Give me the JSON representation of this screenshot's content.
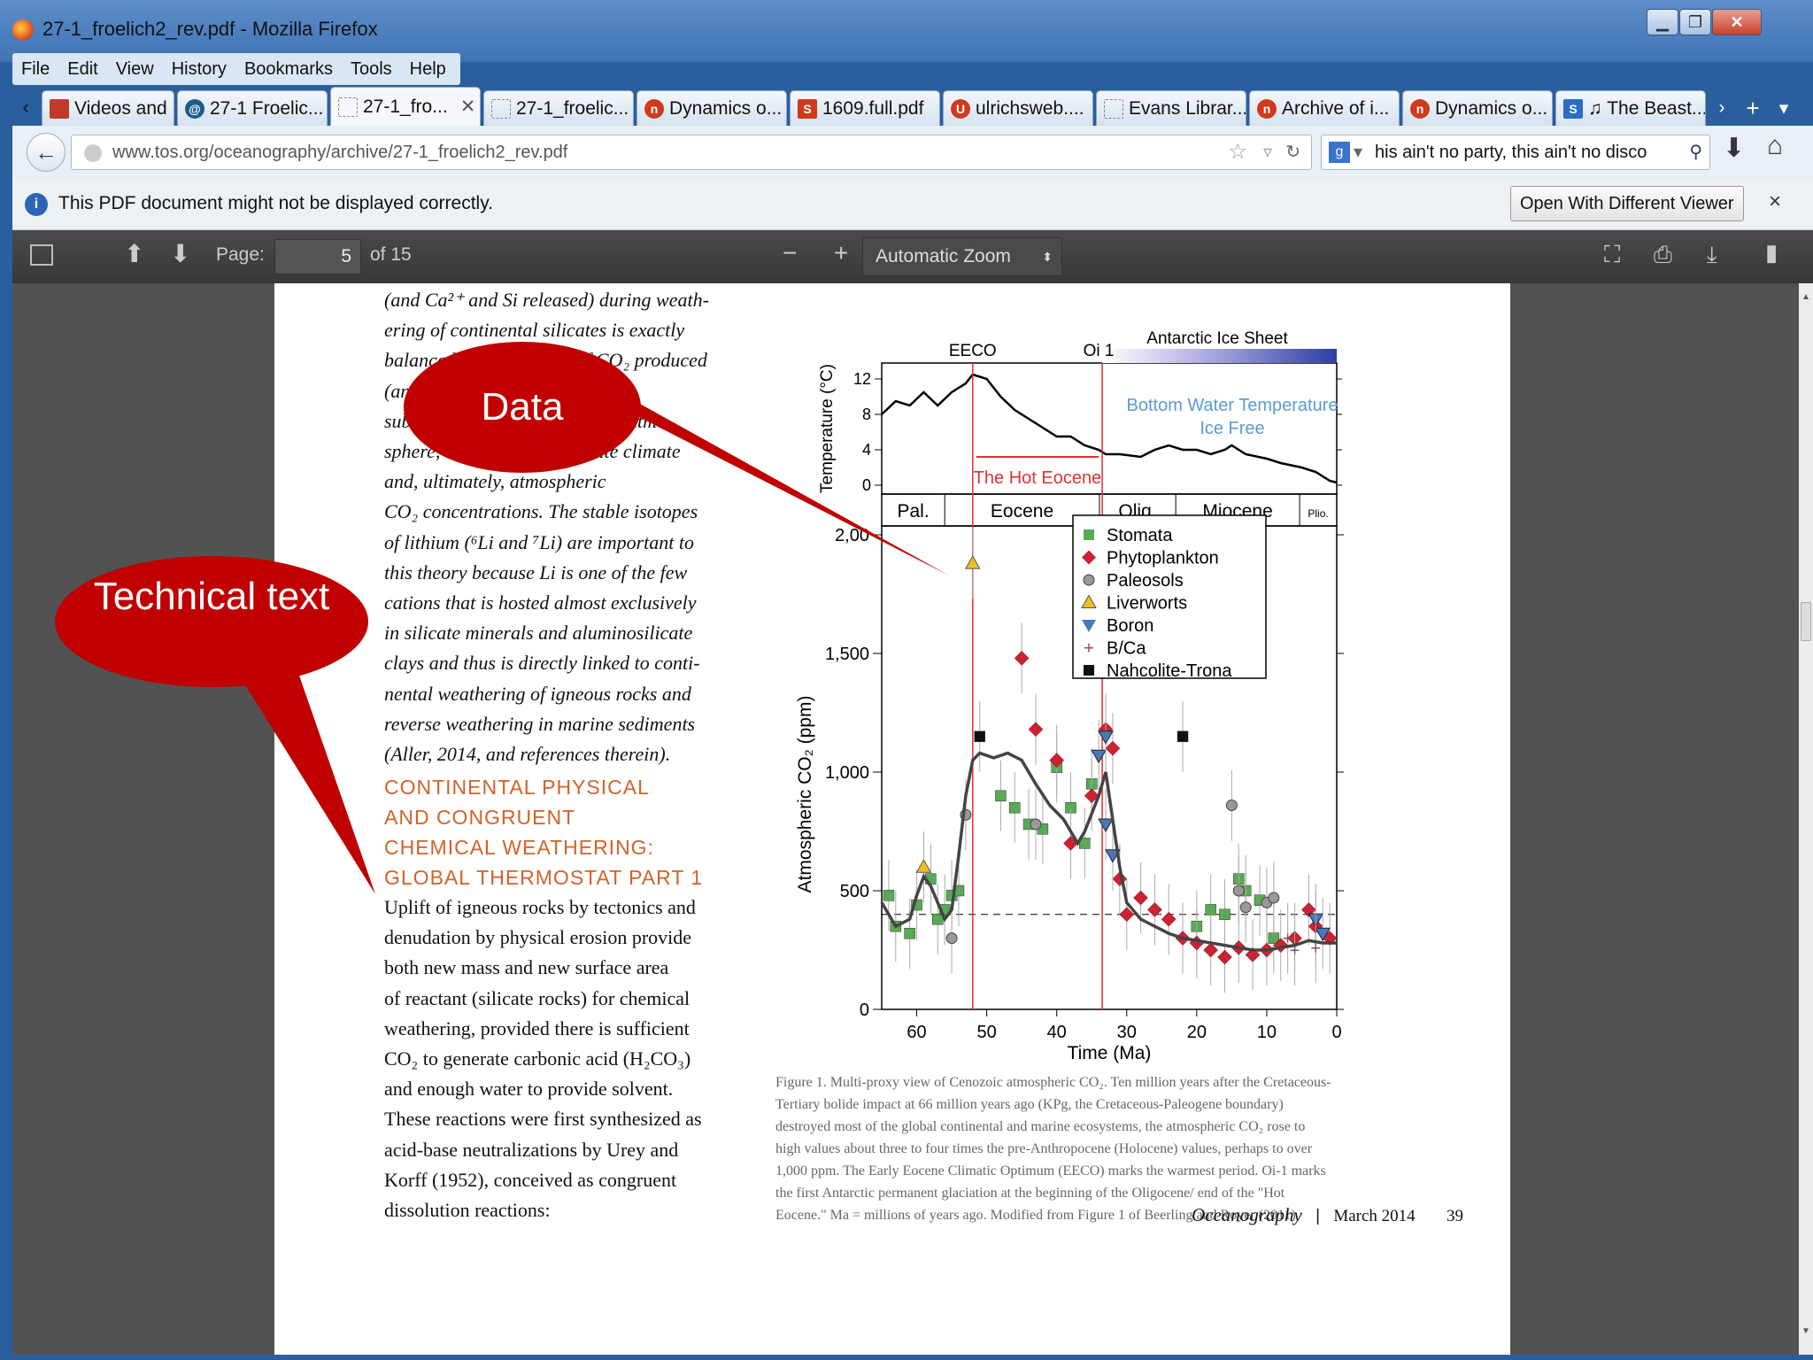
{
  "window": {
    "title": "27-1_froelich2_rev.pdf - Mozilla Firefox"
  },
  "menu": [
    "File",
    "Edit",
    "View",
    "History",
    "Bookmarks",
    "Tools",
    "Help"
  ],
  "tabs": [
    {
      "label": "Videos and I...",
      "icon": "video-icon",
      "color": "#c0392b"
    },
    {
      "label": "27-1 Froelic...",
      "icon": "globe-swirl-icon",
      "color": "#1b5e8a"
    },
    {
      "label": "27-1_fro...",
      "icon": "pdf-page-icon",
      "color": "#888",
      "active": true
    },
    {
      "label": "27-1_froelic...",
      "icon": "pdf-page-icon",
      "color": "#888"
    },
    {
      "label": "Dynamics o...",
      "icon": "library-icon",
      "color": "#d03a1b"
    },
    {
      "label": "1609.full.pdf",
      "icon": "s-icon",
      "color": "#d03a1b"
    },
    {
      "label": "ulrichsweb....",
      "icon": "u-icon",
      "color": "#d03a1b"
    },
    {
      "label": "Evans Librar...",
      "icon": "page-icon",
      "color": "#888"
    },
    {
      "label": "Archive of i...",
      "icon": "library-icon",
      "color": "#d03a1b"
    },
    {
      "label": "Dynamics o...",
      "icon": "library-icon",
      "color": "#d03a1b"
    },
    {
      "label": "♫ The Beast...",
      "icon": "s-blue-icon",
      "color": "#2a6cc7"
    }
  ],
  "nav": {
    "url": "www.tos.org/oceanography/archive/27-1_froelich2_rev.pdf",
    "search": "his ain't no party, this ain't no disco"
  },
  "notification": {
    "text": "This PDF document might not be displayed correctly.",
    "button": "Open With Different Viewer",
    "close": "×"
  },
  "pdf_toolbar": {
    "page_label": "Page:",
    "page_value": "5",
    "page_total": "of 15",
    "zoom": "Automatic Zoom"
  },
  "left_column": {
    "para1_lines": [
      "(and Ca²⁺ and Si released) during weath-",
      "ering of continental silicates is exactly",
      "balanced by the amount of CO₂ produced",
      "(and O₂ consumed) during",
      "subduction outgassing into the atmo-",
      "sphere, which might modulate climate",
      "and, ultimately, atmospheric",
      "CO₂ concentrations. The stable isotopes",
      "of lithium (⁶Li and ⁷Li) are important to",
      "this theory because Li is one of the few",
      "cations that is hosted almost exclusively",
      "in silicate minerals and aluminosilicate",
      "clays and thus is directly linked to conti-",
      "nental weathering of igneous rocks and",
      "reverse weathering in marine sediments",
      "(Aller, 2014, and references therein)."
    ],
    "heading_lines": [
      "CONTINENTAL PHYSICAL",
      "AND CONGRUENT",
      "CHEMICAL WEATHERING:",
      "GLOBAL THERMOSTAT PART 1"
    ],
    "para2_lines": [
      "Uplift of igneous rocks by tectonics and",
      "denudation by physical erosion provide",
      "both new mass and new surface area",
      "of reactant (silicate rocks) for chemical",
      "weathering, provided there is sufficient",
      "CO₂ to generate carbonic acid (H₂CO₃)",
      "and enough water to provide solvent.",
      "These reactions were first synthesized as",
      "acid-base neutralizations by Urey and",
      "Korff (1952), conceived as congruent",
      "dissolution reactions:"
    ]
  },
  "callouts": {
    "data": "Data",
    "technical": "Technical text"
  },
  "caption_lines": [
    "Figure 1. Multi-proxy view of Cenozoic atmospheric CO₂. Ten million years after the Cretaceous-",
    "Tertiary bolide impact at 66 million years ago (KPg, the Cretaceous-Paleogene boundary)",
    "destroyed most of the global continental and marine ecosystems, the atmospheric CO₂ rose to",
    "high values about three to four times the pre-Anthropocene (Holocene) values, perhaps to over",
    "1,000 ppm. The Early Eocene Climatic Optimum (EECO) marks the warmest period. Oi-1 marks",
    "the first Antarctic permanent glaciation at the beginning of the Oligocene/ end of the \"Hot",
    "Eocene.\" Ma = millions of years ago. Modified from Figure 1 of Beerling and Royer (2011)"
  ],
  "footer": {
    "journal": "Oceanography",
    "date": "March 2014",
    "page": "39",
    "sep": "|"
  },
  "chart_data": {
    "type": "scatter",
    "xlabel": "Time (Ma)",
    "x_ticks": [
      60,
      50,
      40,
      30,
      20,
      10,
      0
    ],
    "xlim": [
      65,
      0
    ],
    "top_panel": {
      "ylabel": "Temperature (°C)",
      "y_ticks": [
        12,
        8,
        4,
        0
      ],
      "annotations": [
        "EECO",
        "Oi 1",
        "Antarctic Ice Sheet",
        "Bottom Water Temperature",
        "Ice Free",
        "The Hot Eocene"
      ],
      "temperature": [
        [
          65,
          8
        ],
        [
          63,
          9.5
        ],
        [
          61,
          9
        ],
        [
          59,
          10.5
        ],
        [
          57,
          9
        ],
        [
          55,
          10.5
        ],
        [
          53,
          11.5
        ],
        [
          52,
          12.5
        ],
        [
          50,
          12
        ],
        [
          48,
          10
        ],
        [
          46,
          8.5
        ],
        [
          44,
          7.5
        ],
        [
          42,
          6.5
        ],
        [
          40,
          5.5
        ],
        [
          38,
          5.5
        ],
        [
          36,
          4.5
        ],
        [
          34,
          4
        ],
        [
          33,
          3.5
        ],
        [
          31,
          3.5
        ],
        [
          28,
          3.2
        ],
        [
          26,
          4
        ],
        [
          24,
          4.5
        ],
        [
          22,
          4
        ],
        [
          20,
          4
        ],
        [
          18,
          3.5
        ],
        [
          16,
          4
        ],
        [
          15,
          4.5
        ],
        [
          13,
          3.5
        ],
        [
          10,
          3
        ],
        [
          8,
          2.5
        ],
        [
          5,
          2
        ],
        [
          3,
          1.5
        ],
        [
          1,
          0.5
        ],
        [
          0,
          0.3
        ]
      ]
    },
    "epochs": [
      "Pal.",
      "Eocene",
      "Olig.",
      "Miocene",
      "Plio."
    ],
    "ylabel": "Atmospheric CO₂ (ppm)",
    "y_ticks": [
      0,
      500,
      1000,
      1500,
      2000
    ],
    "y_tick_labels": [
      "0",
      "500",
      "1,000",
      "1,500",
      "2,00"
    ],
    "ylim": [
      0,
      2000
    ],
    "legend": [
      "Stomata",
      "Phytoplankton",
      "Paleosols",
      "Liverworts",
      "Boron",
      "B/Ca",
      "Nahcolite-Trona"
    ],
    "series": [
      {
        "name": "Stomata",
        "marker": "square",
        "color": "#5aaa55",
        "points": [
          [
            64,
            480
          ],
          [
            63,
            350
          ],
          [
            61,
            320
          ],
          [
            60,
            440
          ],
          [
            58,
            550
          ],
          [
            57,
            380
          ],
          [
            56,
            420
          ],
          [
            55,
            480
          ],
          [
            54,
            500
          ],
          [
            48,
            900
          ],
          [
            46,
            850
          ],
          [
            44,
            780
          ],
          [
            42,
            760
          ],
          [
            40,
            1020
          ],
          [
            38,
            850
          ],
          [
            36,
            700
          ],
          [
            35,
            950
          ],
          [
            20,
            350
          ],
          [
            18,
            420
          ],
          [
            16,
            400
          ],
          [
            14,
            550
          ],
          [
            13,
            500
          ],
          [
            11,
            460
          ],
          [
            9,
            300
          ]
        ]
      },
      {
        "name": "Phytoplankton",
        "marker": "diamond",
        "color": "#cc2233",
        "points": [
          [
            45,
            1480
          ],
          [
            43,
            1180
          ],
          [
            40,
            1050
          ],
          [
            38,
            700
          ],
          [
            35,
            900
          ],
          [
            33,
            1180
          ],
          [
            32,
            1100
          ],
          [
            31,
            550
          ],
          [
            30,
            400
          ],
          [
            28,
            470
          ],
          [
            26,
            420
          ],
          [
            24,
            380
          ],
          [
            22,
            300
          ],
          [
            20,
            280
          ],
          [
            18,
            250
          ],
          [
            16,
            220
          ],
          [
            14,
            260
          ],
          [
            12,
            230
          ],
          [
            10,
            250
          ],
          [
            8,
            270
          ],
          [
            6,
            300
          ],
          [
            4,
            420
          ],
          [
            3,
            350
          ],
          [
            1,
            300
          ]
        ]
      },
      {
        "name": "Paleosols",
        "marker": "circle",
        "color": "#999",
        "points": [
          [
            55,
            300
          ],
          [
            53,
            820
          ],
          [
            43,
            780
          ],
          [
            15,
            860
          ],
          [
            14,
            500
          ],
          [
            13,
            430
          ],
          [
            10,
            450
          ],
          [
            9,
            470
          ]
        ]
      },
      {
        "name": "Liverworts",
        "marker": "triangle-up",
        "color": "#f0c020",
        "points": [
          [
            59,
            600
          ],
          [
            52,
            1880
          ]
        ]
      },
      {
        "name": "Boron",
        "marker": "triangle-down",
        "color": "#4a78b8",
        "points": [
          [
            34,
            1070
          ],
          [
            33,
            1150
          ],
          [
            33,
            780
          ],
          [
            32,
            650
          ],
          [
            3,
            380
          ],
          [
            2,
            320
          ]
        ]
      },
      {
        "name": "B/Ca",
        "marker": "plus",
        "color": "#8c4b6e",
        "points": [
          [
            7,
            300
          ],
          [
            6,
            250
          ],
          [
            3,
            260
          ]
        ]
      },
      {
        "name": "Nahcolite-Trona",
        "marker": "square",
        "color": "#111",
        "points": [
          [
            51,
            1150
          ],
          [
            22,
            1150
          ]
        ]
      }
    ],
    "smooth_curve": [
      [
        65,
        450
      ],
      [
        63,
        350
      ],
      [
        61,
        380
      ],
      [
        60,
        480
      ],
      [
        59,
        560
      ],
      [
        58,
        520
      ],
      [
        57,
        450
      ],
      [
        56,
        380
      ],
      [
        55,
        420
      ],
      [
        54,
        650
      ],
      [
        53,
        900
      ],
      [
        52,
        1050
      ],
      [
        51,
        1080
      ],
      [
        49,
        1060
      ],
      [
        47,
        1080
      ],
      [
        45,
        1050
      ],
      [
        43,
        950
      ],
      [
        41,
        860
      ],
      [
        39,
        800
      ],
      [
        37,
        700
      ],
      [
        36,
        750
      ],
      [
        34,
        900
      ],
      [
        33,
        1000
      ],
      [
        32,
        800
      ],
      [
        31,
        600
      ],
      [
        30,
        450
      ],
      [
        28,
        380
      ],
      [
        26,
        350
      ],
      [
        24,
        320
      ],
      [
        22,
        300
      ],
      [
        20,
        290
      ],
      [
        18,
        280
      ],
      [
        16,
        270
      ],
      [
        14,
        260
      ],
      [
        12,
        250
      ],
      [
        10,
        250
      ],
      [
        8,
        260
      ],
      [
        6,
        270
      ],
      [
        4,
        290
      ],
      [
        2,
        280
      ],
      [
        0,
        280
      ]
    ],
    "reference_line": 400,
    "vertical_markers": [
      52,
      33.5
    ]
  }
}
